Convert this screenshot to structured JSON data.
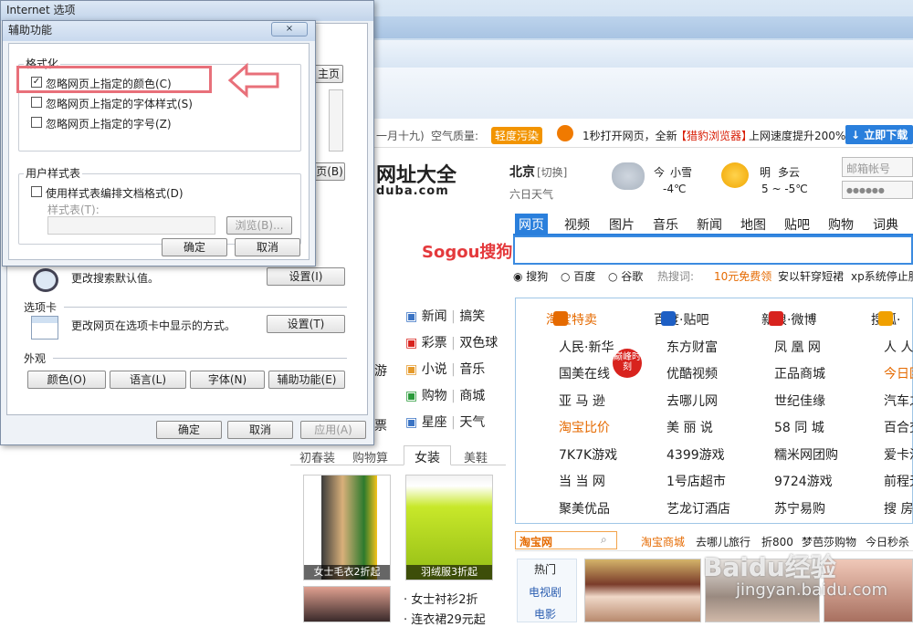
{
  "main_dialog": {
    "title": "Internet 选项",
    "help_glyph": "?",
    "close_glyph": "×",
    "home_btn_partial": "主页",
    "tab_btn_partial": "页(B)",
    "search_desc": "更改搜索默认值。",
    "search_settings": "设置(I)",
    "tabs_heading": "选项卡",
    "tabs_desc": "更改网页在选项卡中显示的方式。",
    "tabs_settings": "设置(T)",
    "appearance_heading": "外观",
    "colors_btn": "颜色(O)",
    "languages_btn": "语言(L)",
    "fonts_btn": "字体(N)",
    "accessibility_btn": "辅助功能(E)",
    "ok": "确定",
    "cancel": "取消",
    "apply": "应用(A)"
  },
  "access_dialog": {
    "title": "辅助功能",
    "close_glyph": "×",
    "format_group": "格式化",
    "ignore_colors": "忽略网页上指定的颜色(C)",
    "ignore_colors_checked": true,
    "ignore_fonts": "忽略网页上指定的字体样式(S)",
    "ignore_sizes": "忽略网页上指定的字号(Z)",
    "user_style_group": "用户样式表",
    "use_stylesheet": "使用样式表编排文档格式(D)",
    "stylesheet_label": "样式表(T):",
    "stylesheet_value": "",
    "browse": "浏览(B)...",
    "ok": "确定",
    "cancel": "取消"
  },
  "annotation": {
    "highlight_color": "#e8707a",
    "arrow_color": "#e8707a"
  },
  "page": {
    "topbar": {
      "lunar": "一月十九)",
      "air_label": "空气质量:",
      "air_value": "轻度污染",
      "promo1": "1秒打开网页，全新",
      "promo_brand": "【猎豹浏览器】",
      "promo2": "上网速度提升200%",
      "download": "↓ 立即下载"
    },
    "logo_cn": "网址大全",
    "logo_en": "duba.com",
    "weather": {
      "city": "北京",
      "switch": "[切换]",
      "six_day": "六日天气",
      "today": "今",
      "today_desc": "小雪",
      "today_temp": "-4℃",
      "tomorrow": "明",
      "tomorrow_desc": "多云",
      "tomorrow_temp": "5 ~ -5℃"
    },
    "login": {
      "placeholder": "邮箱帐号",
      "password": "●●●●●●"
    },
    "search_tabs": [
      "网页",
      "视频",
      "图片",
      "音乐",
      "新闻",
      "地图",
      "贴吧",
      "购物",
      "词典"
    ],
    "sogou": "Sogou搜狗",
    "engines": [
      "搜狗",
      "百度",
      "谷歌"
    ],
    "hot_label": "热搜词:",
    "hot_terms": [
      "10元免费领",
      "安以轩穿短裙",
      "xp系统停止服"
    ],
    "left_links": [
      [
        "新闻",
        "搞笑"
      ],
      [
        "彩票",
        "双色球"
      ],
      [
        "小说",
        "音乐"
      ],
      [
        "购物",
        "商城"
      ],
      [
        "星座",
        "天气"
      ]
    ],
    "left_partial": [
      "游",
      "票"
    ],
    "sites": [
      [
        "淘宝特卖",
        "百度·贴吧",
        "新浪·微博",
        "搜狐·"
      ],
      [
        "人民·新华",
        "东方财富",
        "凤 凰 网",
        "人 人 网"
      ],
      [
        "国美在线",
        "优酷视频",
        "正品商城",
        "今日团购"
      ],
      [
        "亚 马 逊",
        "去哪儿网",
        "世纪佳缘",
        "汽车之家"
      ],
      [
        "淘宝比价",
        "美 丽 说",
        "58 同 城",
        "百合交友"
      ],
      [
        "7K7K游戏",
        "4399游戏",
        "糯米网团购",
        "爱卡汽车"
      ],
      [
        "当 当 网",
        "1号店超市",
        "9724游戏",
        "前程无忧"
      ],
      [
        "聚美优品",
        "艺龙订酒店",
        "苏宁易购",
        "搜 房 网"
      ]
    ],
    "badge": "巅峰时刻",
    "shop_tabs": [
      "初春装",
      "购物算",
      "女装",
      "美鞋"
    ],
    "shop_items": [
      {
        "caption": "女士毛衣2折起"
      },
      {
        "caption": "羽绒服3折起"
      }
    ],
    "shop_list": [
      "· 女士衬衫2折",
      "· 连衣裙29元起"
    ],
    "taobao": {
      "label": "淘宝网",
      "links": [
        "淘宝商城",
        "去哪儿旅行",
        "折800",
        "梦芭莎购物",
        "今日秒杀"
      ]
    },
    "hot_tabs": [
      "热门",
      "电视剧",
      "电影"
    ],
    "watermark": "Baidu经验",
    "watermark_url": "jingyan.baidu.com"
  }
}
